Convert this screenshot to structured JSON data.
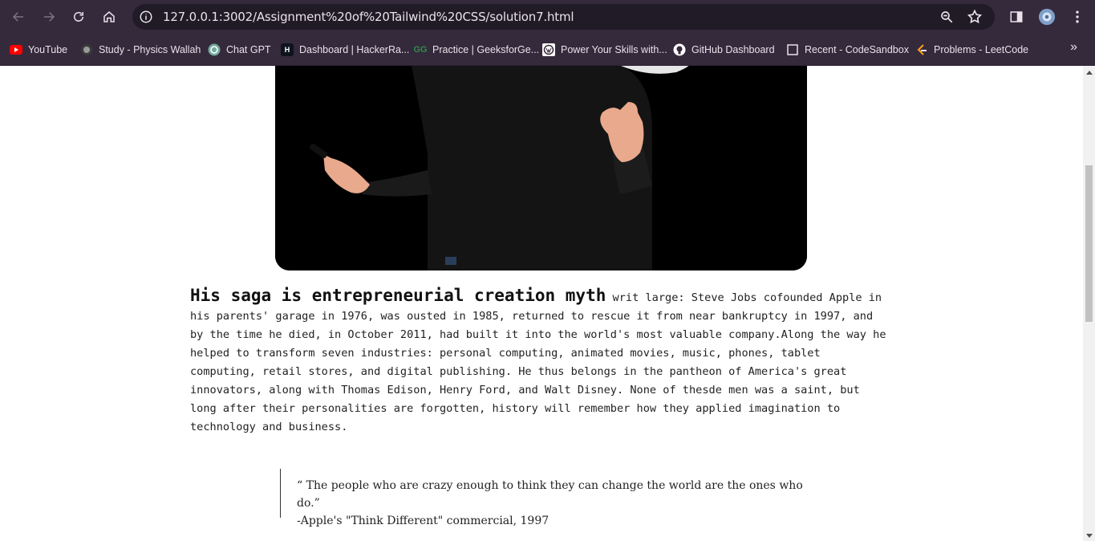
{
  "browser": {
    "url": "127.0.0.1:3002/Assignment%20of%20Tailwind%20CSS/solution7.html",
    "bookmarks": [
      {
        "label": "YouTube",
        "icon": "youtube-icon"
      },
      {
        "label": "Study - Physics Wallah",
        "icon": "physics-wallah-icon"
      },
      {
        "label": "Chat GPT",
        "icon": "chatgpt-icon"
      },
      {
        "label": "Dashboard | HackerRa...",
        "icon": "hackerrank-icon"
      },
      {
        "label": "Practice | GeeksforGe...",
        "icon": "geeksforgeeks-icon"
      },
      {
        "label": "Power Your Skills with...",
        "icon": "wordpress-icon"
      },
      {
        "label": "GitHub Dashboard",
        "icon": "github-icon"
      },
      {
        "label": "Recent - CodeSandbox",
        "icon": "codesandbox-icon"
      },
      {
        "label": "Problems - LeetCode",
        "icon": "leetcode-icon"
      }
    ],
    "more_label": "»"
  },
  "article": {
    "lead": "His saga is entrepreneurial creation myth",
    "body": " writ large: Steve Jobs cofounded Apple in his parents' garage in 1976, was ousted in 1985, returned to rescue it from near bankruptcy in 1997, and by the time he died, in October 2011, had built it into the world's most valuable company.Along the way he helped to transform seven industries: personal computing, animated movies, music, phones, tablet computing, retail stores, and digital publishing. He thus belongs in the pantheon of America's great innovators, along with Thomas Edison, Henry Ford, and Walt Disney. None of thesde men was a saint, but long after their personalities are forgotten, history will remember how they applied imagination to technology and business."
  },
  "quote": {
    "text": "“ The people who are crazy enough to think they can change the world are the ones who do.”",
    "attribution": "-Apple's \"Think Different\" commercial, 1997"
  },
  "colors": {
    "chrome": "#35293c",
    "omnibox": "#211a27",
    "youtube": "#ff0000",
    "hackerrank": "#0e141e",
    "gfg": "#2f8d46"
  }
}
